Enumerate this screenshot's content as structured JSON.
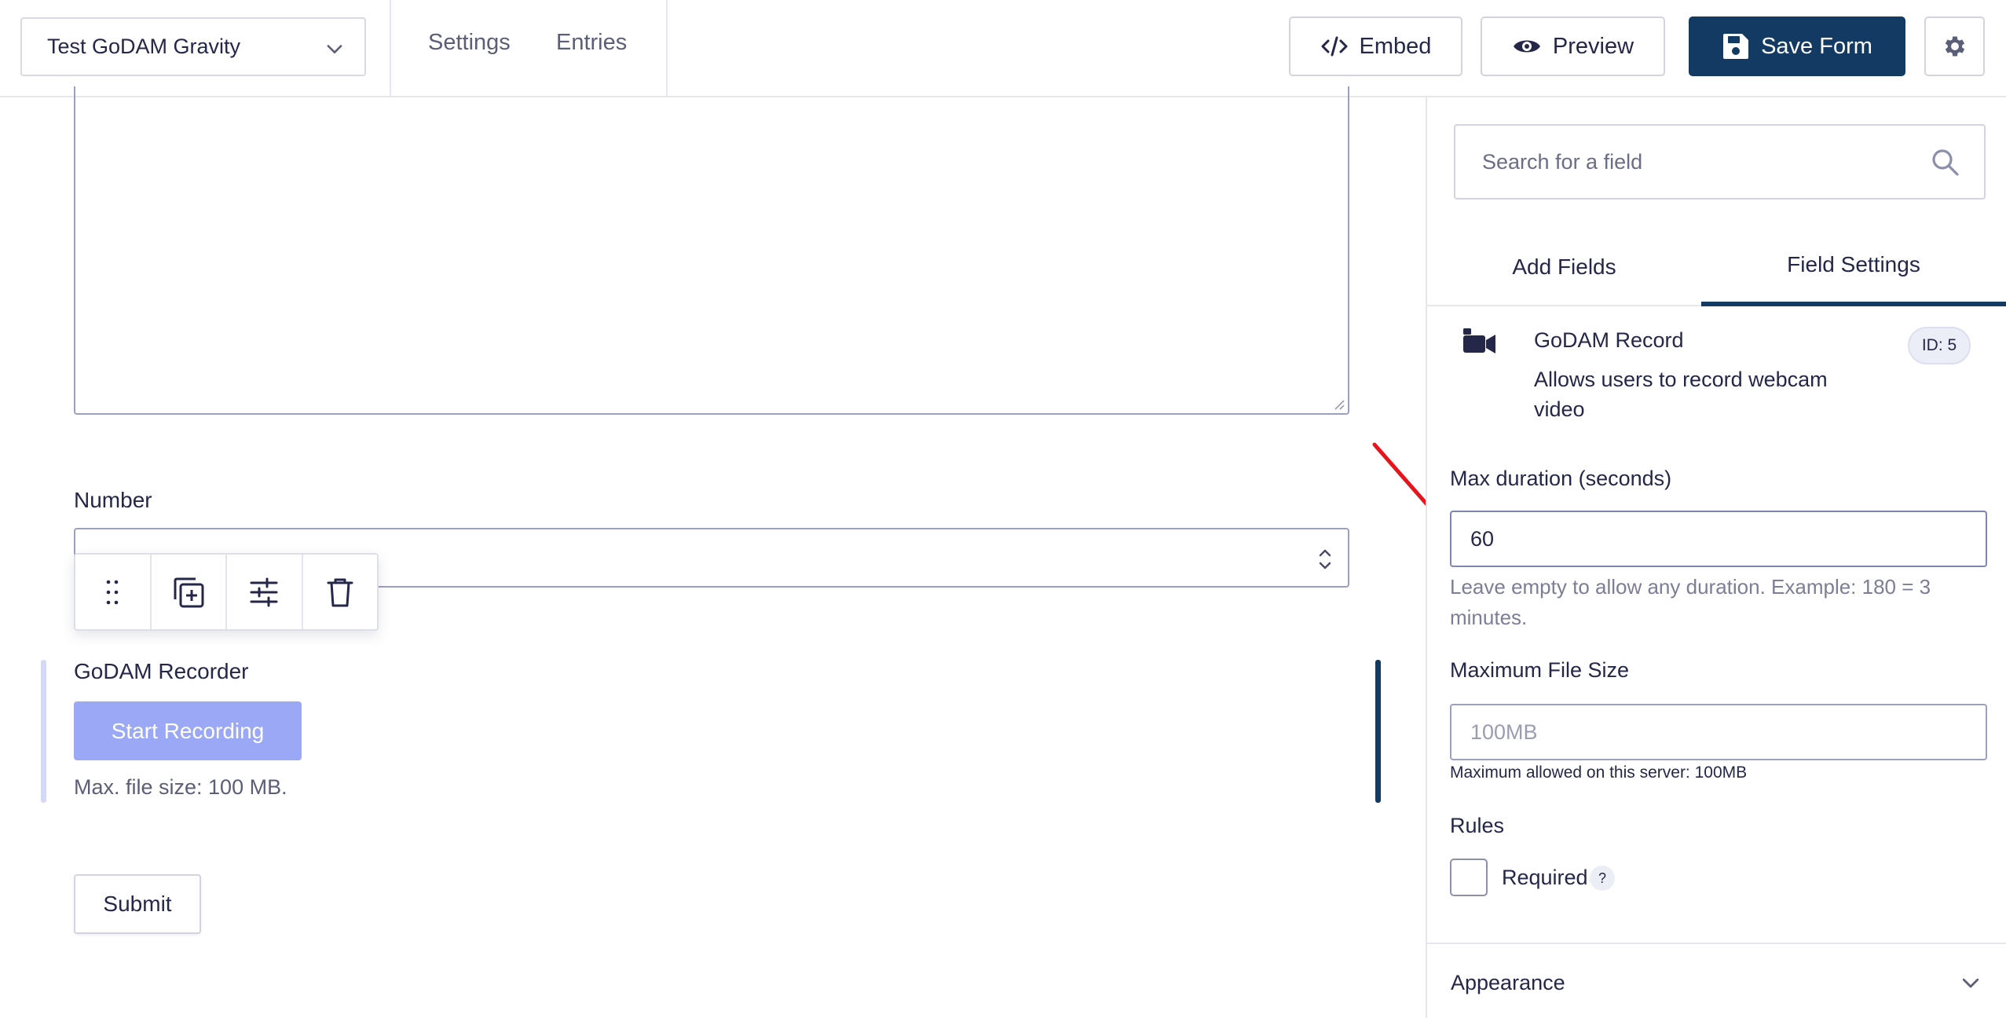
{
  "header": {
    "form_name": "Test GoDAM Gravity",
    "links": [
      "Settings",
      "Entries"
    ],
    "embed_label": "Embed",
    "preview_label": "Preview",
    "save_label": "Save Form"
  },
  "canvas": {
    "number_label": "Number",
    "recorder_label": "GoDAM Recorder",
    "record_button": "Start Recording",
    "file_size_hint": "Max. file size: 100 MB.",
    "submit_label": "Submit"
  },
  "sidebar": {
    "search_placeholder": "Search for a field",
    "tabs": [
      "Add Fields",
      "Field Settings"
    ],
    "field": {
      "title": "GoDAM Record",
      "description": "Allows users to record webcam video",
      "id_badge": "ID: 5"
    },
    "max_duration": {
      "label": "Max duration (seconds)",
      "value": "60",
      "help": "Leave empty to allow any duration. Example: 180 = 3 minutes."
    },
    "max_file_size": {
      "label": "Maximum File Size",
      "placeholder": "100MB",
      "note": "Maximum allowed on this server: 100MB"
    },
    "rules": {
      "label": "Rules",
      "required_label": "Required",
      "help_mark": "?"
    },
    "appearance_label": "Appearance"
  },
  "colors": {
    "primary": "#133a62",
    "record_button": "#9ba8f5",
    "annotation_arrow": "#e8141c"
  }
}
